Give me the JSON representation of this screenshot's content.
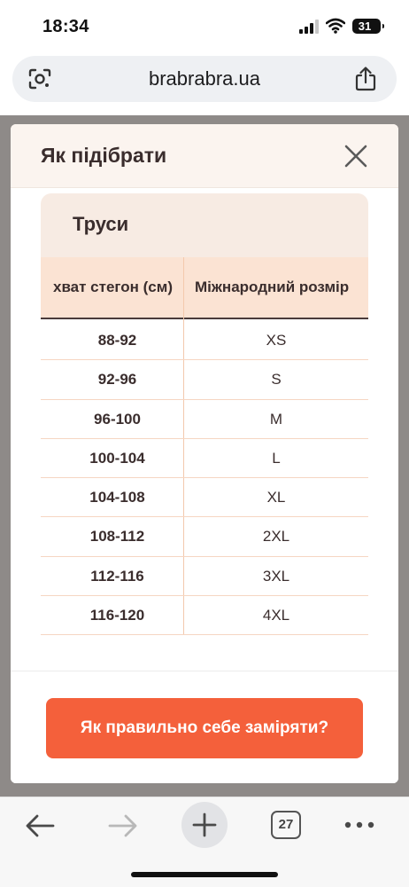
{
  "status_bar": {
    "time": "18:34",
    "battery": "31"
  },
  "browser": {
    "url": "brabrabra.ua",
    "tab_count": "27"
  },
  "modal": {
    "title": "Як підібрати",
    "table": {
      "title": "Труси",
      "headers": [
        "хват стегон (см)",
        "Міжнародний розмір"
      ],
      "rows": [
        [
          "88-92",
          "XS"
        ],
        [
          "92-96",
          "S"
        ],
        [
          "96-100",
          "M"
        ],
        [
          "100-104",
          "L"
        ],
        [
          "104-108",
          "XL"
        ],
        [
          "108-112",
          "2XL"
        ],
        [
          "112-116",
          "3XL"
        ],
        [
          "116-120",
          "4XL"
        ]
      ]
    },
    "cta_label": "Як правильно себе заміряти?"
  },
  "colors": {
    "accent": "#f4603b",
    "header_bg": "#fbe3d3",
    "text": "#3a2d2d"
  },
  "icons": [
    "google-lens-icon",
    "share-icon",
    "close-icon",
    "back-arrow-icon",
    "forward-arrow-icon",
    "plus-icon",
    "tabs-icon",
    "more-icon"
  ]
}
